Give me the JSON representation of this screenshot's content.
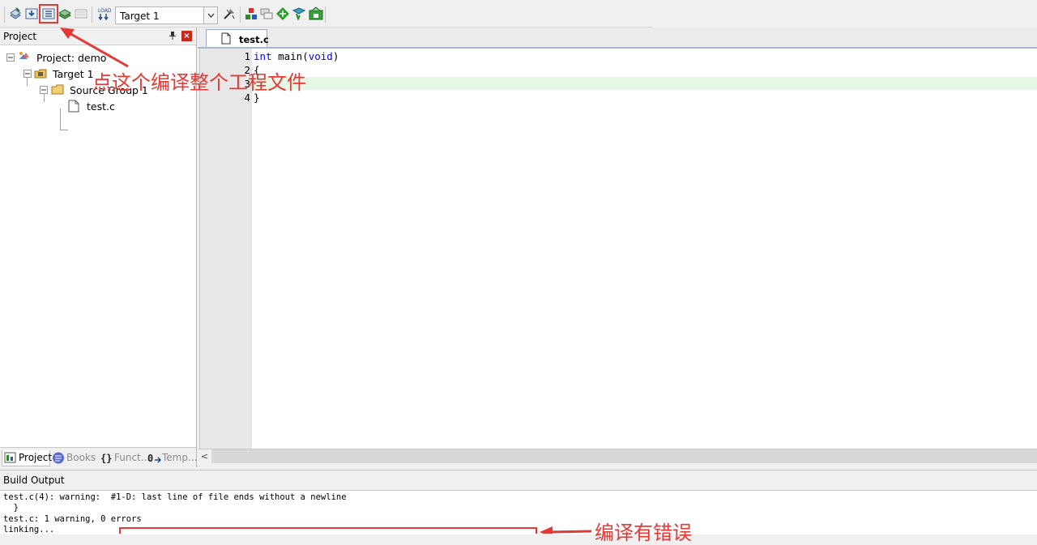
{
  "toolbar": {
    "target_select_value": "Target 1",
    "icons": [
      "translate-icon",
      "build-icon",
      "rebuild-icon",
      "batch-build-icon",
      "stop-build-icon",
      "download-icon",
      "target-options-icon",
      "manage-components-icon",
      "select-packs-icon",
      "pack-installer-icon",
      "manage-run-time-icon",
      "manage-multi-project-icon"
    ]
  },
  "project_panel": {
    "title": "Project",
    "tree": {
      "project": "Project: demo",
      "target": "Target 1",
      "group": "Source Group 1",
      "file": "test.c"
    },
    "tabs": [
      {
        "label": "Project"
      },
      {
        "label": "Books"
      },
      {
        "label": "Funct..."
      },
      {
        "label": "Temp..."
      }
    ]
  },
  "editor": {
    "tab_label": "test.c",
    "line_numbers": [
      "1",
      "2",
      "3",
      "4"
    ],
    "code": {
      "kw_int": "int",
      "main": " main(",
      "kw_void": "void",
      "close_paren": ")",
      "line2": "{",
      "line3": "",
      "line4": "}"
    },
    "scroll_left": "<"
  },
  "build_output": {
    "title": "Build Output",
    "lines": [
      "test.c(4): warning:  #1-D: last line of file ends without a newline",
      "  }",
      "test.c: 1 warning, 0 errors",
      "linking..."
    ]
  },
  "annotations": {
    "toolbar_callout": "点这个编译整个工程文件",
    "build_callout": "编译有错误",
    "color": "#e53935"
  }
}
